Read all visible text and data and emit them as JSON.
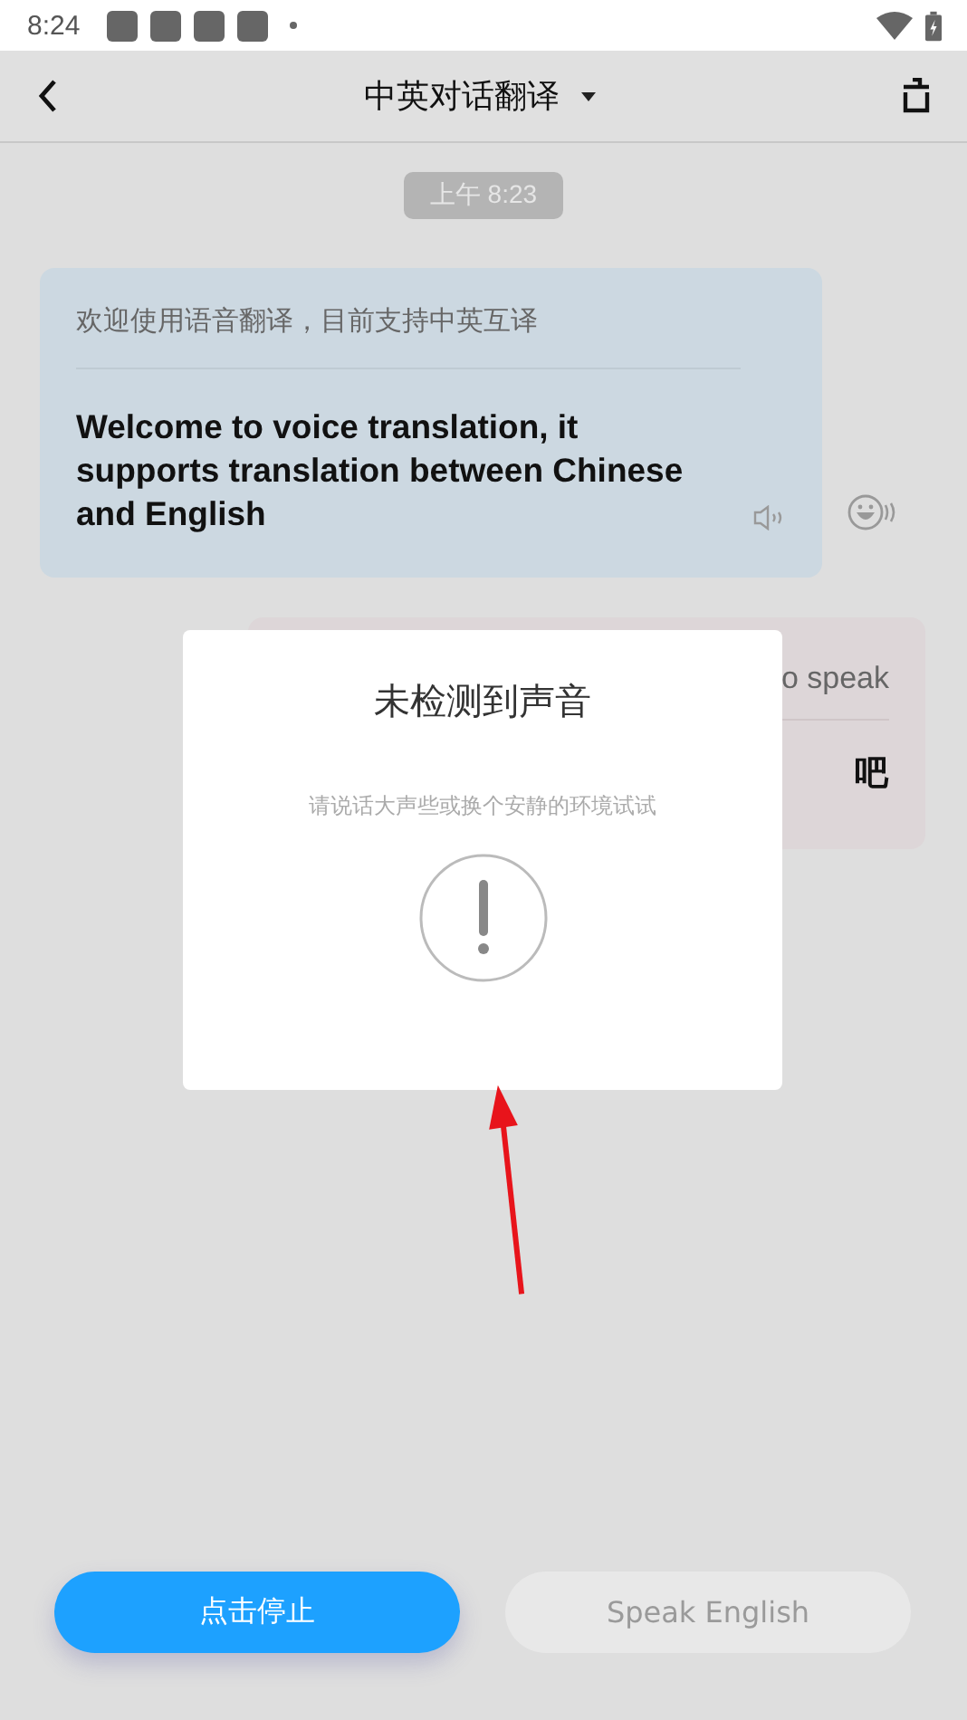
{
  "status_bar": {
    "time": "8:24"
  },
  "header": {
    "title": "中英对话翻译"
  },
  "timestamp": "上午 8:23",
  "messages": [
    {
      "kind": "incoming",
      "source": "欢迎使用语音翻译，目前支持中英互译",
      "translation": "Welcome to voice translation, it supports translation between Chinese and English"
    },
    {
      "kind": "outgoing",
      "source": "o speak",
      "translation": "吧"
    }
  ],
  "dialog": {
    "title": "未检测到声音",
    "message": "请说话大声些或换个安静的环境试试"
  },
  "buttons": [
    {
      "label": "点击停止",
      "selected": true
    },
    {
      "label": "Speak English",
      "selected": false
    }
  ]
}
